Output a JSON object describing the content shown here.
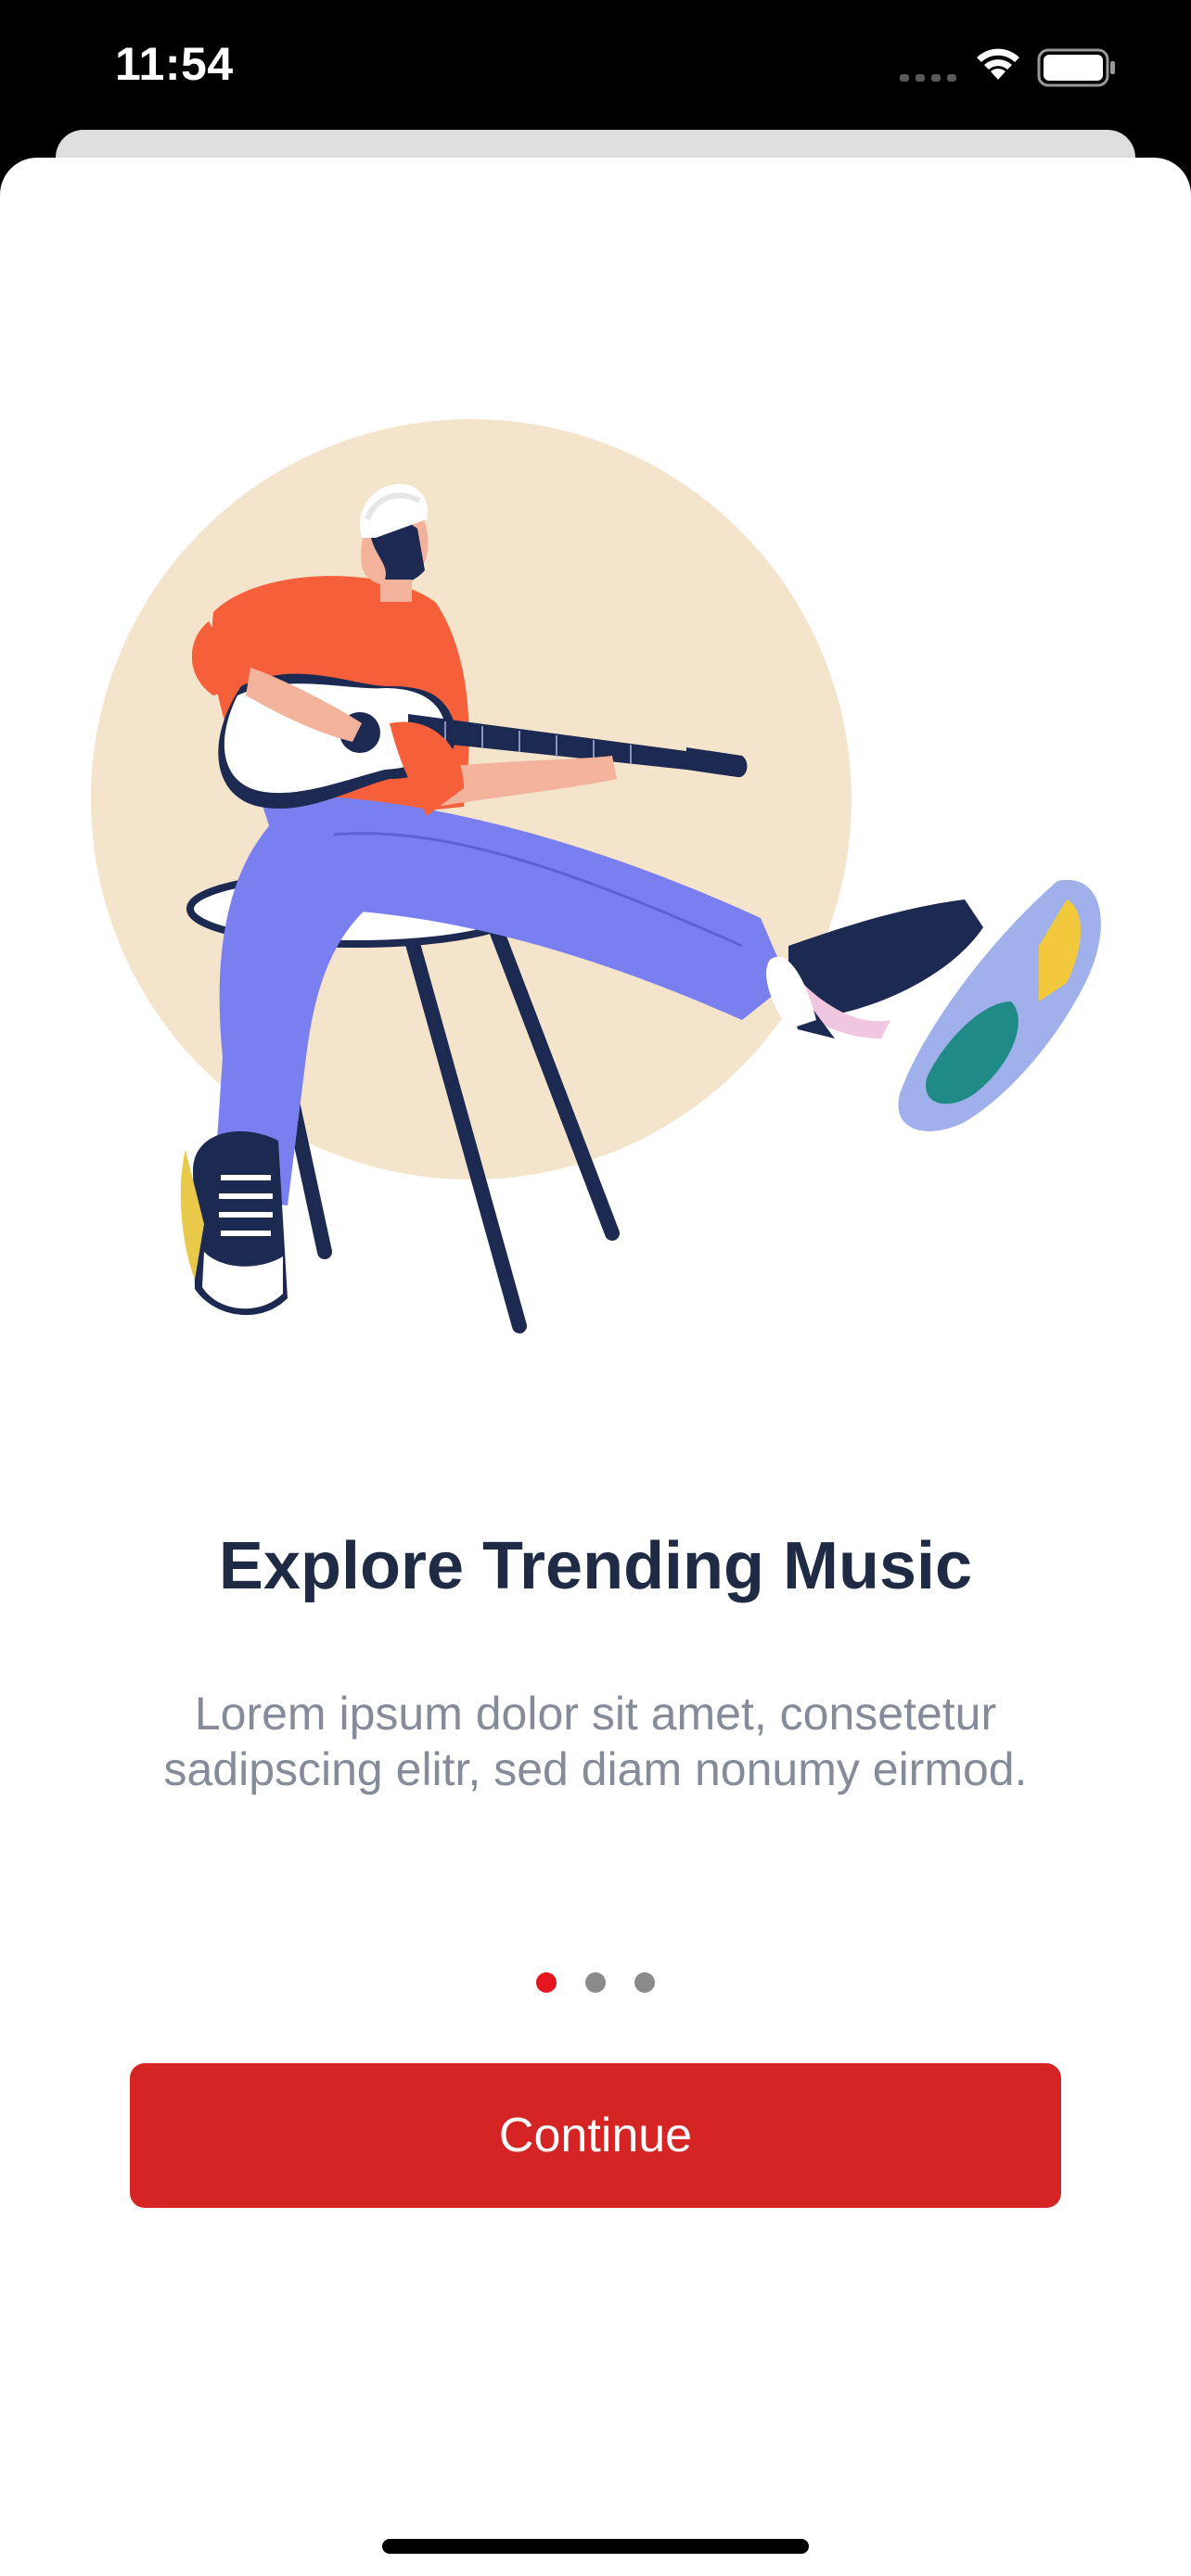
{
  "status_bar": {
    "time": "11:54",
    "signal_icon": "signal-dots-icon",
    "wifi_icon": "wifi-icon",
    "battery_icon": "battery-icon"
  },
  "onboarding": {
    "illustration": "guitarist-on-stool-illustration",
    "title": "Explore Trending Music",
    "description": "Lorem ipsum dolor sit amet, consetetur sadipscing elitr, sed diam nonumy eirmod.",
    "page_indicator": {
      "total": 3,
      "current": 1
    },
    "continue_label": "Continue"
  },
  "colors": {
    "accent": "#d42424",
    "active_dot": "#e5161f",
    "inactive_dot": "#8a8a8a",
    "title": "#1f2b45",
    "body_text": "#858b98",
    "circle_bg": "#f5e4cc"
  }
}
